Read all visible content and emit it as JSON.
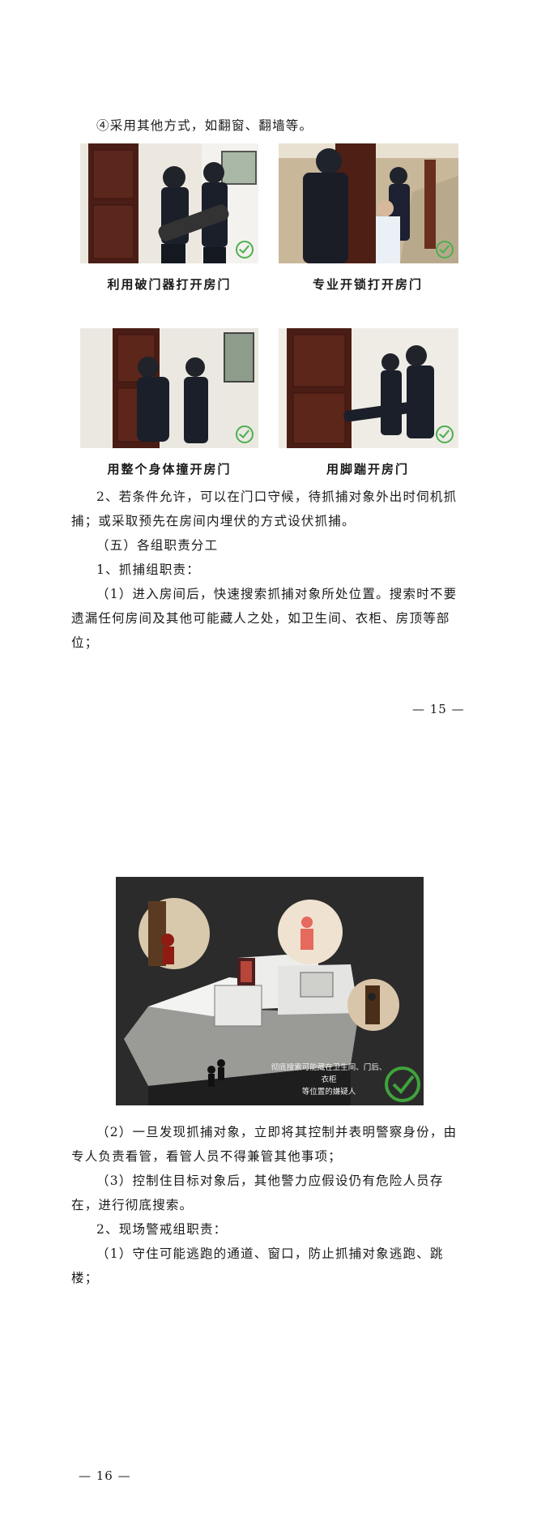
{
  "page1": {
    "line_item4": "④采用其他方式，如翻窗、翻墙等。",
    "captions": [
      "利用破门器打开房门",
      "专业开锁打开房门",
      "用整个身体撞开房门",
      "用脚踹开房门"
    ],
    "para_2": "2、若条件允许，可以在门口守候，待抓捕对象外出时伺机抓捕；或采取预先在房间内埋伏的方式设伏抓捕。",
    "heading_5": "（五）各组职责分工",
    "heading_1": "1、抓捕组职责：",
    "para_1_1": "（1）进入房间后，快速搜索抓捕对象所处位置。搜索时不要遗漏任何房间及其他可能藏人之处，如卫生间、衣柜、房顶等部位；",
    "page_number": "— 15 —"
  },
  "page2": {
    "diagram_caption_line1": "彻底搜索可能藏在卫生间、门后、衣柜",
    "diagram_caption_line2": "等位置的嫌疑人",
    "para_2_item": "（2）一旦发现抓捕对象，立即将其控制并表明警察身份，由专人负责看管，看管人员不得兼管其他事项；",
    "para_3_item": "（3）控制住目标对象后，其他警力应假设仍有危险人员存在，进行彻底搜索。",
    "heading_2": "2、现场警戒组职责：",
    "para_2_1": "（1）守住可能逃跑的通道、窗口，防止抓捕对象逃跑、跳楼；",
    "page_number": "— 16 —"
  }
}
